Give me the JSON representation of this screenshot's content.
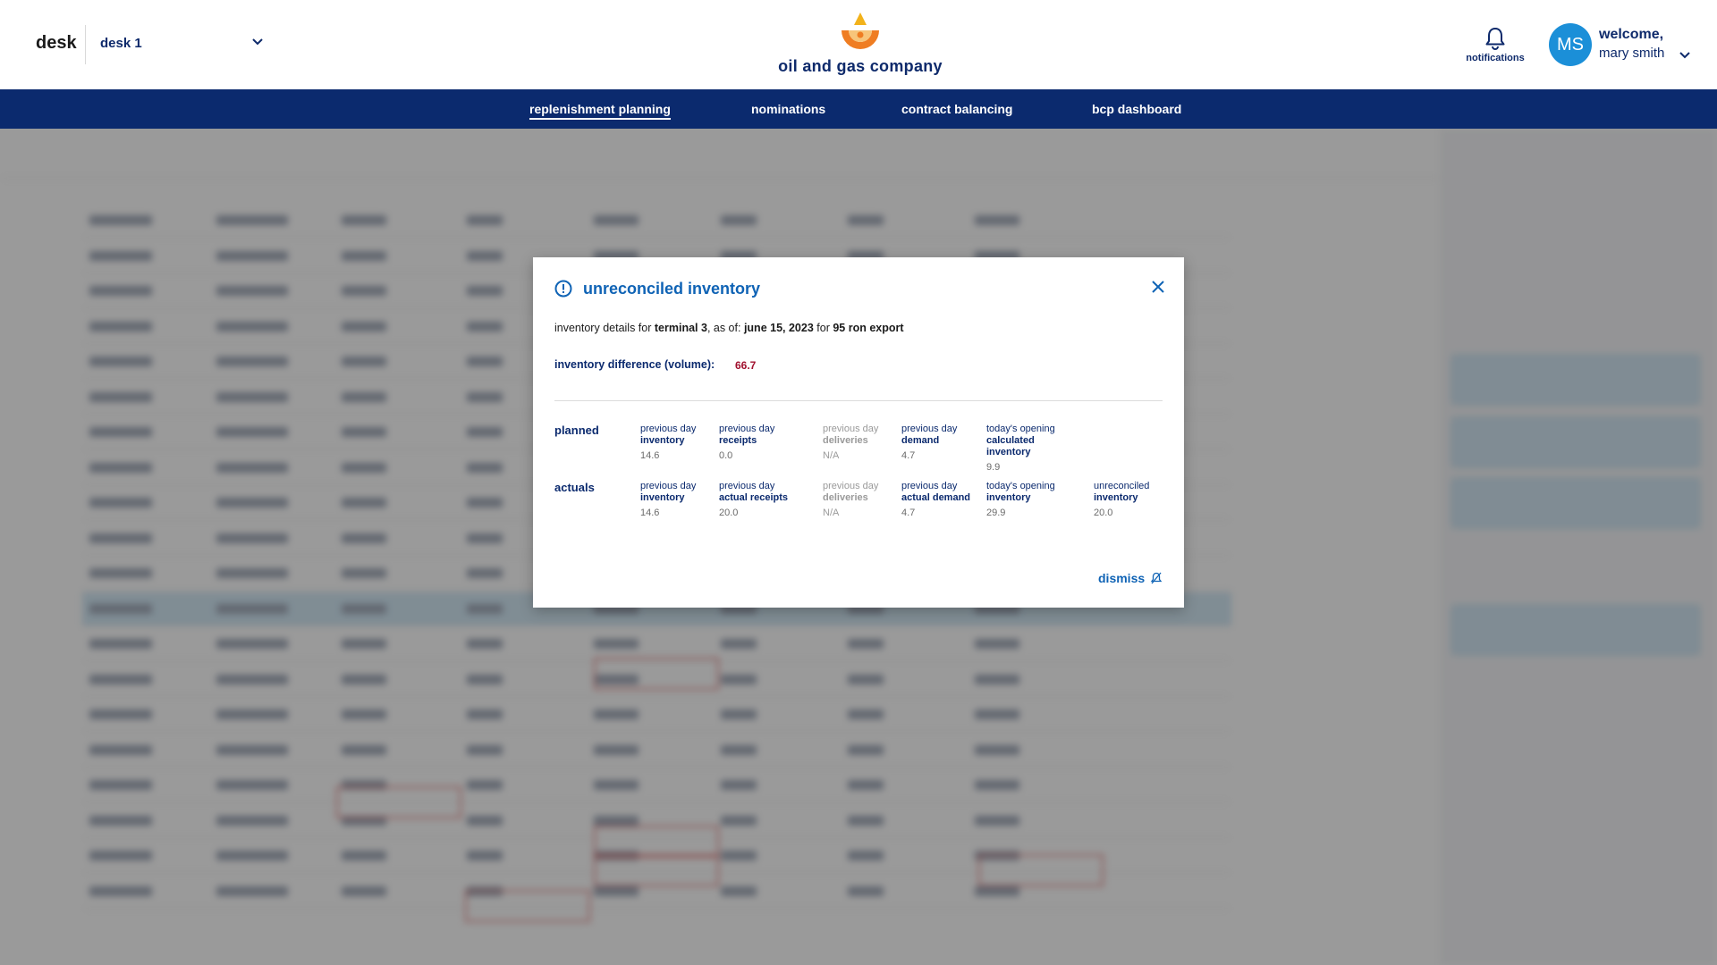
{
  "header": {
    "app_label": "desk",
    "desk_select_value": "desk 1",
    "company_name": "oil and gas company",
    "notifications_label": "notifications",
    "user_initials": "MS",
    "welcome_text": "welcome,",
    "user_name": "mary smith"
  },
  "nav": {
    "items": [
      {
        "label": "replenishment planning",
        "active": true
      },
      {
        "label": "nominations",
        "active": false
      },
      {
        "label": "contract balancing",
        "active": false
      },
      {
        "label": "bcp dashboard",
        "active": false
      }
    ]
  },
  "modal": {
    "title": "unreconciled inventory",
    "details_prefix": "inventory details for",
    "terminal": "terminal 3",
    "as_of_text": ", as of:",
    "date": "june 15, 2023",
    "for_text": "for",
    "product": "95 ron export",
    "difference_label": "inventory difference (volume):",
    "difference_value": "66.7",
    "planned": {
      "label": "planned",
      "fields": [
        {
          "top": "previous day",
          "bottom": "inventory",
          "value": "14.6"
        },
        {
          "top": "previous day",
          "bottom": "receipts",
          "value": "0.0"
        },
        {
          "top": "previous day",
          "bottom": "deliveries",
          "value": "N/A"
        },
        {
          "top": "previous day",
          "bottom": "demand",
          "value": "4.7"
        },
        {
          "top": "today's opening",
          "bottom": "calculated inventory",
          "value": "9.9"
        }
      ]
    },
    "actuals": {
      "label": "actuals",
      "fields": [
        {
          "top": "previous day",
          "bottom": "inventory",
          "value": "14.6"
        },
        {
          "top": "previous day",
          "bottom": "actual receipts",
          "value": "20.0"
        },
        {
          "top": "previous day",
          "bottom": "deliveries",
          "value": "N/A"
        },
        {
          "top": "previous day",
          "bottom": "actual demand",
          "value": "4.7"
        },
        {
          "top": "today's opening",
          "bottom": "inventory",
          "value": "29.9"
        },
        {
          "top": "unreconciled",
          "bottom": "inventory",
          "value": "20.0"
        }
      ]
    },
    "dismiss_label": "dismiss"
  },
  "colors": {
    "nav_bg": "#0b2a6e",
    "accent": "#0f63b5",
    "avatar_bg": "#1b8fd8",
    "difference_value": "#a1102e"
  }
}
